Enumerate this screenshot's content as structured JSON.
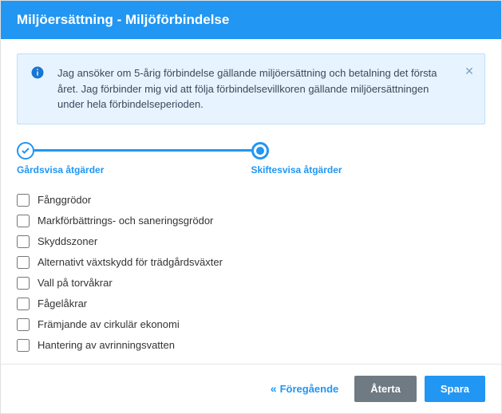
{
  "header": {
    "title": "Miljöersättning - Miljöförbindelse"
  },
  "alert": {
    "text": "Jag ansöker om 5-årig förbindelse gällande miljöersättning och betalning det första året. Jag förbinder mig vid att följa förbindelsevillkoren gällande miljöersättningen under hela förbindelseperioden."
  },
  "stepper": {
    "steps": [
      {
        "label": "Gårdsvisa åtgärder",
        "state": "done"
      },
      {
        "label": "Skiftesvisa åtgärder",
        "state": "current"
      }
    ]
  },
  "options": [
    {
      "label": "Fånggrödor",
      "checked": false
    },
    {
      "label": "Markförbättrings- och saneringsgrödor",
      "checked": false
    },
    {
      "label": "Skyddszoner",
      "checked": false
    },
    {
      "label": "Alternativt växtskydd för trädgårdsväxter",
      "checked": false
    },
    {
      "label": "Vall på torvåkrar",
      "checked": false
    },
    {
      "label": "Fågelåkrar",
      "checked": false
    },
    {
      "label": "Främjande av cirkulär ekonomi",
      "checked": false
    },
    {
      "label": "Hantering av avrinningsvatten",
      "checked": false
    }
  ],
  "footer": {
    "prev": "Föregående",
    "reset": "Återta",
    "save": "Spara"
  }
}
